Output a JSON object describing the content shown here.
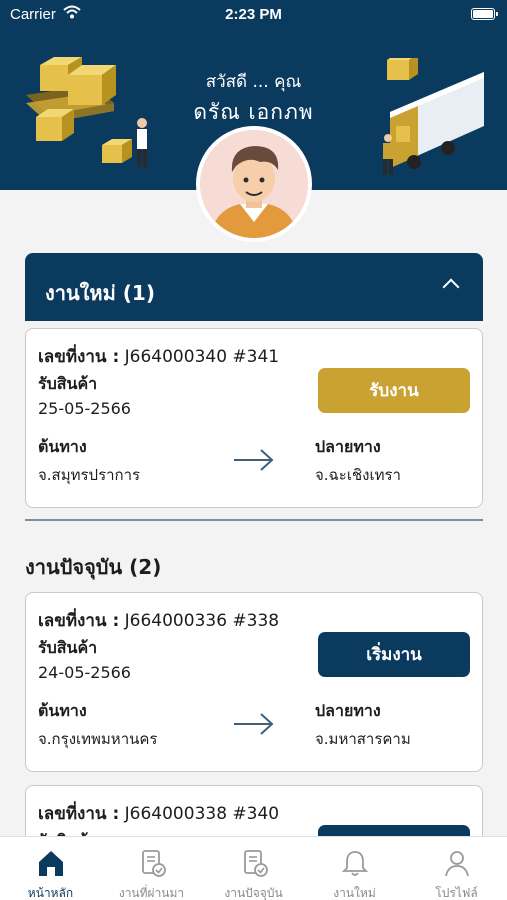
{
  "status": {
    "carrier": "Carrier",
    "time": "2:23 PM"
  },
  "header": {
    "greeting": "สวัสดี ... คุณ",
    "name": "ดรัณ  เอกภพ"
  },
  "new_jobs": {
    "title": "งานใหม่ (1)",
    "cards": [
      {
        "job_label": "เลขที่งาน :",
        "job_no": "J664000340 #341",
        "pickup_label": "รับสินค้า",
        "pickup_date": "25-05-2566",
        "origin_label": "ต้นทาง",
        "origin": "จ.สมุทรปราการ",
        "dest_label": "ปลายทาง",
        "dest": "จ.ฉะเชิงเทรา",
        "button": "รับงาน"
      }
    ]
  },
  "current_jobs": {
    "title": "งานปัจจุบัน (2)",
    "cards": [
      {
        "job_label": "เลขที่งาน :",
        "job_no": "J664000336 #338",
        "pickup_label": "รับสินค้า",
        "pickup_date": "24-05-2566",
        "origin_label": "ต้นทาง",
        "origin": "จ.กรุงเทพมหานคร",
        "dest_label": "ปลายทาง",
        "dest": "จ.มหาสารคาม",
        "button": "เริ่มงาน"
      },
      {
        "job_label": "เลขที่งาน :",
        "job_no": "J664000338 #340",
        "pickup_label": "รับสินค้า"
      }
    ]
  },
  "tabs": [
    {
      "label": "หน้าหลัก",
      "icon": "home-icon",
      "active": true
    },
    {
      "label": "งานที่ผ่านมา",
      "icon": "document-check-icon"
    },
    {
      "label": "งานปัจจุบัน",
      "icon": "document-check-icon"
    },
    {
      "label": "งานใหม่",
      "icon": "bell-icon"
    },
    {
      "label": "โปรไฟล์",
      "icon": "user-icon"
    }
  ],
  "colors": {
    "primary": "#0b3a5f",
    "accent": "#c9a232",
    "background": "#f3f3f3"
  }
}
